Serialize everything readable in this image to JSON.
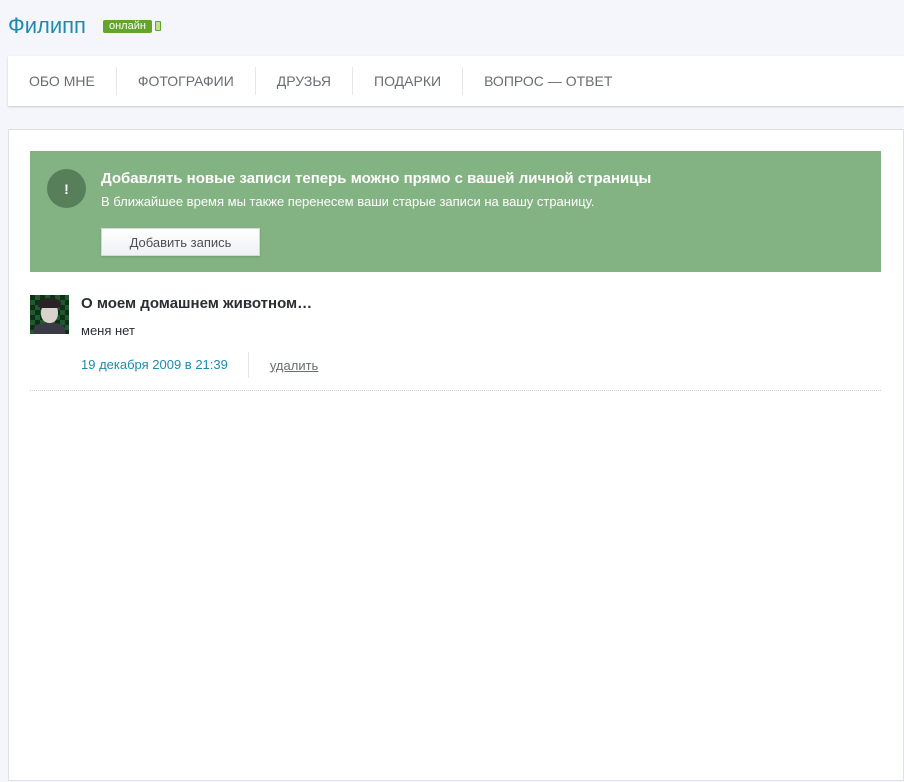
{
  "profile": {
    "name": "Филипп",
    "status_badge": "онлайн",
    "status_icon": "mobile-phone-icon"
  },
  "tabs": [
    {
      "label": "ОБО МНЕ"
    },
    {
      "label": "ФОТОГРАФИИ"
    },
    {
      "label": "ДРУЗЬЯ"
    },
    {
      "label": "ПОДАРКИ"
    },
    {
      "label": "ВОПРОС — ОТВЕТ"
    }
  ],
  "notice": {
    "icon": "exclamation-icon",
    "icon_glyph": "!",
    "title": "Добавлять новые записи теперь можно прямо с вашей личной страницы",
    "text": "В ближайшее время мы также перенесем ваши старые записи на вашу страницу.",
    "button_label": "Добавить запись"
  },
  "post": {
    "title": "О моем домашнем животном…",
    "body": "меня нет",
    "date": "19 декабря 2009 в 21:39",
    "delete_label": "удалить"
  },
  "colors": {
    "accent": "#1d8bb0",
    "online_badge": "#62a52a",
    "notice_background": "#84b383",
    "notice_icon_background": "#57805a"
  }
}
